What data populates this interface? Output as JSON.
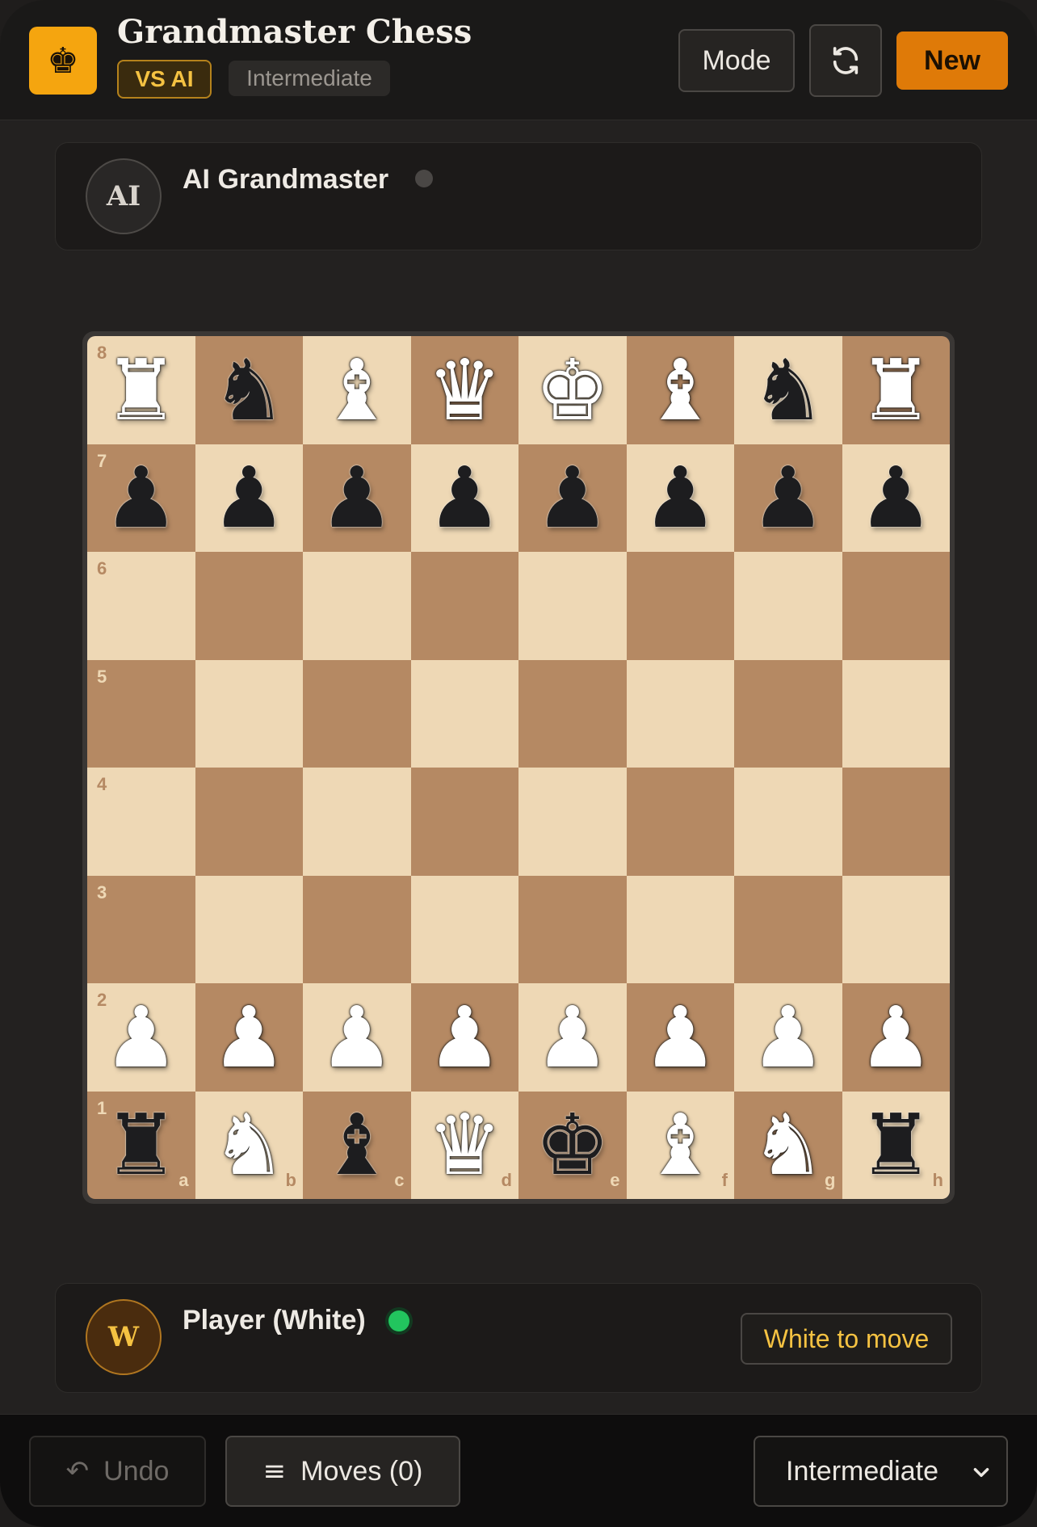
{
  "header": {
    "logo_icon": "♚",
    "title": "Grandmaster Chess",
    "mode_badge": "VS AI",
    "level_badge": "Intermediate",
    "mode_button": "Mode",
    "refresh_icon": "⟳",
    "new_button": "New"
  },
  "opponent": {
    "avatar": "AI",
    "name": "AI Grandmaster",
    "status": "offline"
  },
  "player": {
    "avatar": "W",
    "name": "Player (White)",
    "status": "online",
    "turn_label": "White to move"
  },
  "board": {
    "ranks": [
      "8",
      "7",
      "6",
      "5",
      "4",
      "3",
      "2",
      "1"
    ],
    "files": [
      "a",
      "b",
      "c",
      "d",
      "e",
      "f",
      "g",
      "h"
    ],
    "position": [
      [
        "wR",
        "bN",
        "wB",
        "wQ",
        "wK",
        "wB",
        "bN",
        "wR"
      ],
      [
        "bP",
        "bP",
        "bP",
        "bP",
        "bP",
        "bP",
        "bP",
        "bP"
      ],
      [
        "",
        "",
        "",
        "",
        "",
        "",
        "",
        ""
      ],
      [
        "",
        "",
        "",
        "",
        "",
        "",
        "",
        ""
      ],
      [
        "",
        "",
        "",
        "",
        "",
        "",
        "",
        ""
      ],
      [
        "",
        "",
        "",
        "",
        "",
        "",
        "",
        ""
      ],
      [
        "wP",
        "wP",
        "wP",
        "wP",
        "wP",
        "wP",
        "wP",
        "wP"
      ],
      [
        "bR",
        "wN",
        "bB",
        "wQ",
        "bK",
        "wB",
        "wN",
        "bR"
      ]
    ],
    "colors": {
      "light": "#eed8b5",
      "dark": "#b58963"
    }
  },
  "footer": {
    "undo_icon": "↶",
    "undo_label": "Undo",
    "moves_icon": "≡",
    "moves_label": "Moves (0)",
    "level_select": "Intermediate",
    "level_chevron": "⌄"
  }
}
